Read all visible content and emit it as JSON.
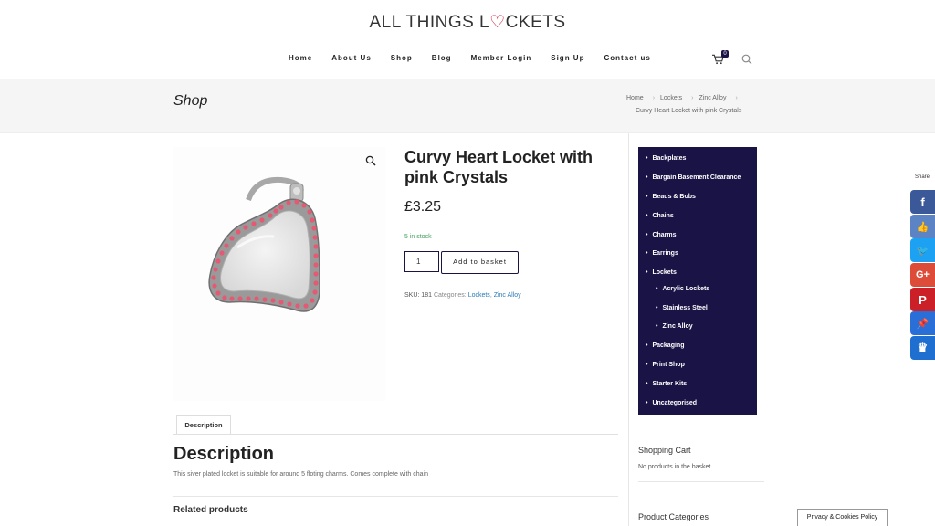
{
  "site": {
    "logo_prefix": "ALL THINGS L",
    "logo_heart": "♡",
    "logo_suffix": "CKETS"
  },
  "nav": {
    "items": [
      "Home",
      "About Us",
      "Shop",
      "Blog",
      "Member Login",
      "Sign Up",
      "Contact us"
    ],
    "cart_count": "0"
  },
  "titlebar": {
    "title": "Shop",
    "breadcrumb": [
      "Home",
      "Lockets",
      "Zinc Alloy"
    ],
    "current": "Curvy Heart Locket with pink Crystals"
  },
  "product": {
    "title": "Curvy Heart Locket with pink Crystals",
    "price": "£3.25",
    "stock": "5 in stock",
    "qty": "1",
    "add_label": "Add to basket",
    "sku_label": "SKU:",
    "sku": "181",
    "categories_label": "Categories:",
    "categories": [
      "Lockets",
      "Zinc Alloy"
    ]
  },
  "tabs": {
    "description_tab": "Description",
    "description_heading": "Description",
    "description_text": "This siver plated locket is suitable for around 5 floting charms. Comes complete with chain",
    "related_heading": "Related products"
  },
  "sidebar": {
    "categories": [
      {
        "label": "Backplates"
      },
      {
        "label": "Bargain Basement Clearance"
      },
      {
        "label": "Beads & Bobs"
      },
      {
        "label": "Chains"
      },
      {
        "label": "Charms"
      },
      {
        "label": "Earrings"
      },
      {
        "label": "Lockets"
      },
      {
        "label": "Acrylic Lockets",
        "sub": true
      },
      {
        "label": "Stainless Steel",
        "sub": true
      },
      {
        "label": "Zinc Alloy",
        "sub": true
      },
      {
        "label": "Packaging"
      },
      {
        "label": "Print Shop"
      },
      {
        "label": "Starter Kits"
      },
      {
        "label": "Uncategorised"
      }
    ],
    "cart_title": "Shopping Cart",
    "cart_empty": "No products in the basket.",
    "product_categories_title": "Product Categories"
  },
  "share": {
    "label": "Share",
    "buttons": [
      {
        "name": "facebook",
        "glyph": "f",
        "color": "#3b5998"
      },
      {
        "name": "like",
        "glyph": "👍",
        "color": "#5c84c4"
      },
      {
        "name": "twitter",
        "glyph": "🐦",
        "color": "#1da1f2"
      },
      {
        "name": "google-plus",
        "glyph": "G+",
        "color": "#dd4b39"
      },
      {
        "name": "pinterest",
        "glyph": "P",
        "color": "#cb2027"
      },
      {
        "name": "pin",
        "glyph": "📌",
        "color": "#2a6fd8"
      },
      {
        "name": "crown",
        "glyph": "♛",
        "color": "#1e6fd0"
      }
    ]
  },
  "privacy": {
    "label": "Privacy & Cookies Policy"
  },
  "colors": {
    "brand_navy": "#1a1346",
    "link_blue": "#2a7ab8",
    "stock_green": "#44a060",
    "heart_red": "#c8102e"
  }
}
